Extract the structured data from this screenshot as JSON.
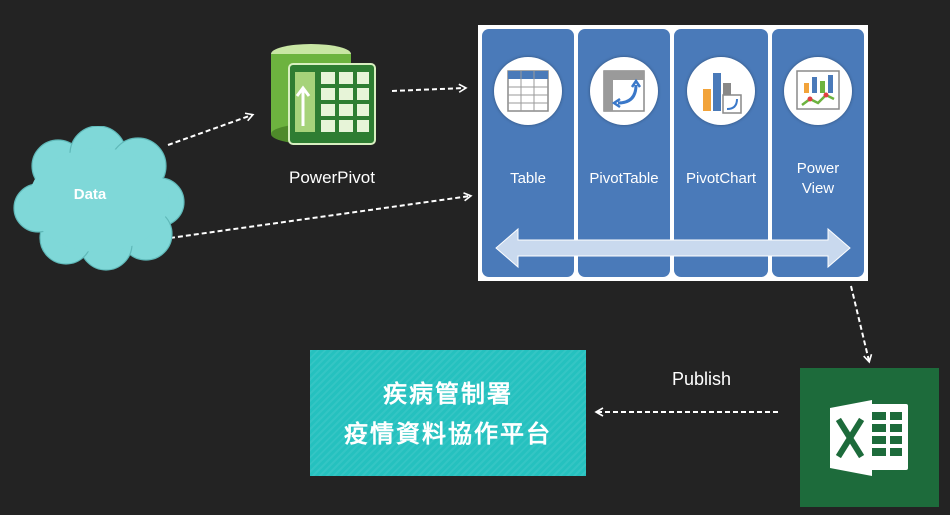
{
  "data_source": {
    "label": "Data"
  },
  "powerpivot": {
    "label": "PowerPivot",
    "icon": "powerpivot-icon"
  },
  "tools": [
    {
      "label": "Table",
      "icon": "table-icon"
    },
    {
      "label": "PivotTable",
      "icon": "pivottable-icon"
    },
    {
      "label": "PivotChart",
      "icon": "pivotchart-icon"
    },
    {
      "label_line1": "Power",
      "label_line2": "View",
      "icon": "powerview-icon"
    }
  ],
  "publish": {
    "label": "Publish"
  },
  "platform": {
    "line1": "疾病管制署",
    "line2": "疫情資料協作平台"
  },
  "excel": {
    "icon": "excel-icon"
  },
  "colors": {
    "background": "#232323",
    "cloud": "#7fd8d8",
    "panel_column": "#4a7ab9",
    "platform": "#25c1bf",
    "excel": "#1d6b3b",
    "powerpivot": "#6db33f"
  }
}
